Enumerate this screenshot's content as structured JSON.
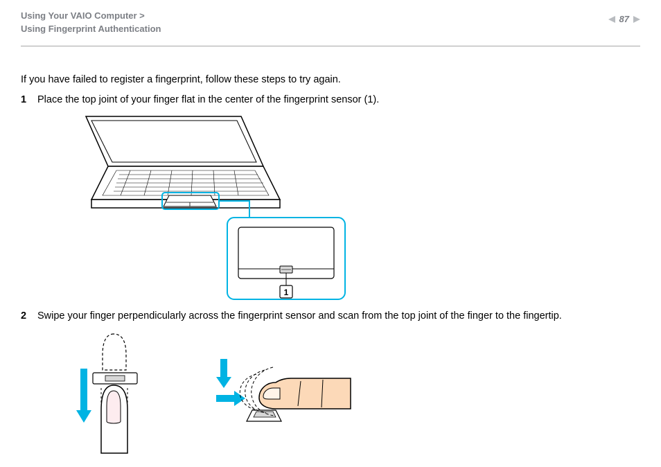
{
  "header": {
    "breadcrumb_line1": "Using Your VAIO Computer >",
    "breadcrumb_line2": "Using Fingerprint Authentication",
    "page_number": "87"
  },
  "body": {
    "intro": "If you have failed to register a fingerprint, follow these steps to try again.",
    "step1_num": "1",
    "step1_text": "Place the top joint of your finger flat in the center of the fingerprint sensor (1).",
    "step2_num": "2",
    "step2_text": "Swipe your finger perpendicularly across the fingerprint sensor and scan from the top joint of the finger to the fingertip.",
    "callout_label": "1"
  },
  "icons": {
    "prev": "prev-page-icon",
    "next": "next-page-icon"
  },
  "colors": {
    "accent": "#00b3e3",
    "header_grey": "#7c7f85",
    "arrow_grey": "#b9bcc0"
  }
}
